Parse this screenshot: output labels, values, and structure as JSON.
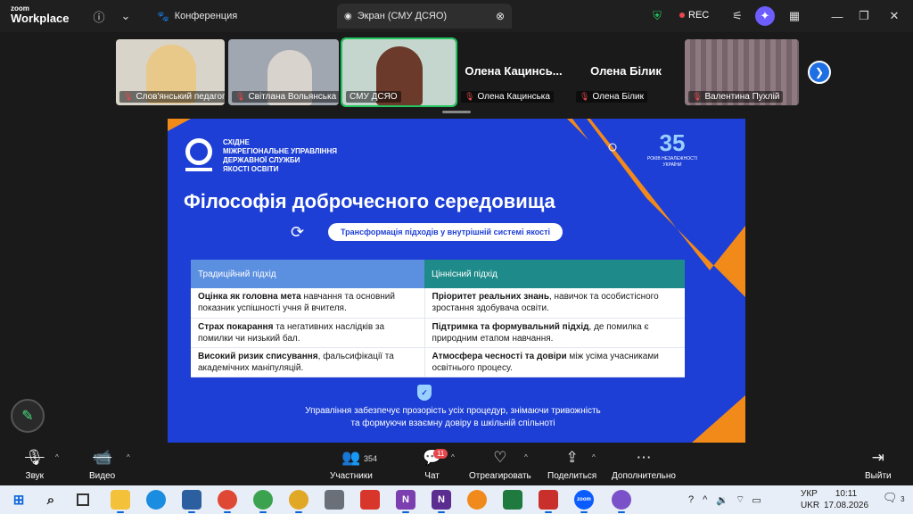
{
  "app": {
    "logo_small": "zoom",
    "logo_big": "Workplace"
  },
  "topbar": {
    "tab_conference": "Конференция",
    "tab_screen": "Экран (СМУ ДСЯО)",
    "rec_label": "REC"
  },
  "participants": [
    {
      "name": "Слов'янський педагог...",
      "muted": true
    },
    {
      "name": "Світлана Вольянська",
      "muted": true
    },
    {
      "name": "СМУ ДСЯО",
      "muted": false
    },
    {
      "name": "Олена Кацинська",
      "display": "Олена Кацинсь...",
      "muted": true
    },
    {
      "name": "Олена Білик",
      "display": "Олена Білик",
      "muted": true
    },
    {
      "name": "Валентина Пухлій",
      "muted": true
    }
  ],
  "slide": {
    "org": "СХІДНЕ\nМІЖРЕГІОНАЛЬНЕ УПРАВЛІННЯ\nДЕРЖАВНОЇ СЛУЖБИ\nЯКОСТІ ОСВІТИ",
    "emblem_number": "35",
    "emblem_text": "РОКІВ НЕЗАЛЕЖНОСТІ УКРАЇНИ",
    "title": "Філософія доброчесного середовища",
    "pill": "Трансформація підходів у внутрішній системі якості",
    "col1_header": "Традиційний підхід",
    "col2_header": "Ціннісний підхід",
    "rows": [
      {
        "c1_bold": "Оцінка як головна мета",
        "c1_rest": " навчання та основний показник успішності учня й вчителя.",
        "c2_bold": "Пріоритет реальних знань",
        "c2_rest": ", навичок та особистісного зростання здобувача освіти."
      },
      {
        "c1_bold": "Страх покарання",
        "c1_rest": " та негативних наслідків за помилки чи низький бал.",
        "c2_bold": "Підтримка та формувальний підхід",
        "c2_rest": ", де помилка є природним етапом навчання."
      },
      {
        "c1_bold": "Високий ризик списування",
        "c1_rest": ", фальсифікації та академічних маніпуляцій.",
        "c2_bold": "Атмосфера чесності та довіри",
        "c2_rest": " між усіма учасниками освітнього процесу."
      }
    ],
    "footer_line1": "Управління забезпечує прозорість усіх процедур, знімаючи тривожність",
    "footer_line2": "та формуючи взаємну довіру в шкільній спільноті"
  },
  "controls": {
    "audio": "Звук",
    "video": "Видео",
    "participants": "Участники",
    "participants_count": "354",
    "chat": "Чат",
    "chat_badge": "11",
    "react": "Отреагировать",
    "share": "Поделиться",
    "more": "Дополнительно",
    "leave": "Выйти"
  },
  "taskbar": {
    "lang_top": "УКР",
    "lang_bottom": "UKR",
    "time": "10:11",
    "date": "17.08.2026",
    "notif_count": "3"
  },
  "colors": {
    "slide_bg": "#1d3fd6",
    "accent_orange": "#f28a1a",
    "active_speaker": "#22c55e",
    "zoom_blue": "#1e6fe3"
  }
}
